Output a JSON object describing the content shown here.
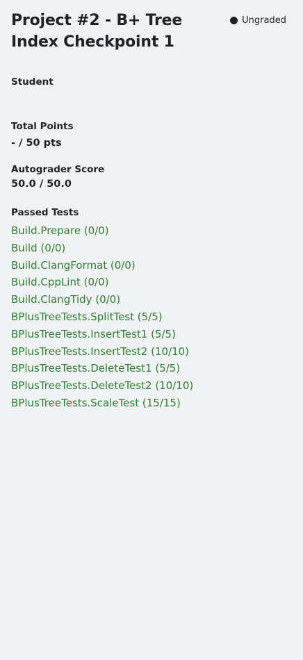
{
  "header": {
    "title": "Project #2 - B+ Tree Index Checkpoint 1",
    "status_label": "Ungraded"
  },
  "student": {
    "label": "Student"
  },
  "total_points": {
    "label": "Total Points",
    "value": "- / 50 pts"
  },
  "autograder": {
    "label": "Autograder Score",
    "value": "50.0 / 50.0"
  },
  "passed_tests": {
    "label": "Passed Tests",
    "items": [
      "Build.Prepare (0/0)",
      "Build (0/0)",
      "Build.ClangFormat (0/0)",
      "Build.CppLint (0/0)",
      "Build.ClangTidy (0/0)",
      "BPlusTreeTests.SplitTest (5/5)",
      "BPlusTreeTests.InsertTest1 (5/5)",
      "BPlusTreeTests.InsertTest2 (10/10)",
      "BPlusTreeTests.DeleteTest1 (5/5)",
      "BPlusTreeTests.DeleteTest2 (10/10)",
      "BPlusTreeTests.ScaleTest (15/15)"
    ]
  },
  "colors": {
    "background": "#f1f2f4",
    "text": "#1f2328",
    "passed_test": "#2e7d32"
  }
}
